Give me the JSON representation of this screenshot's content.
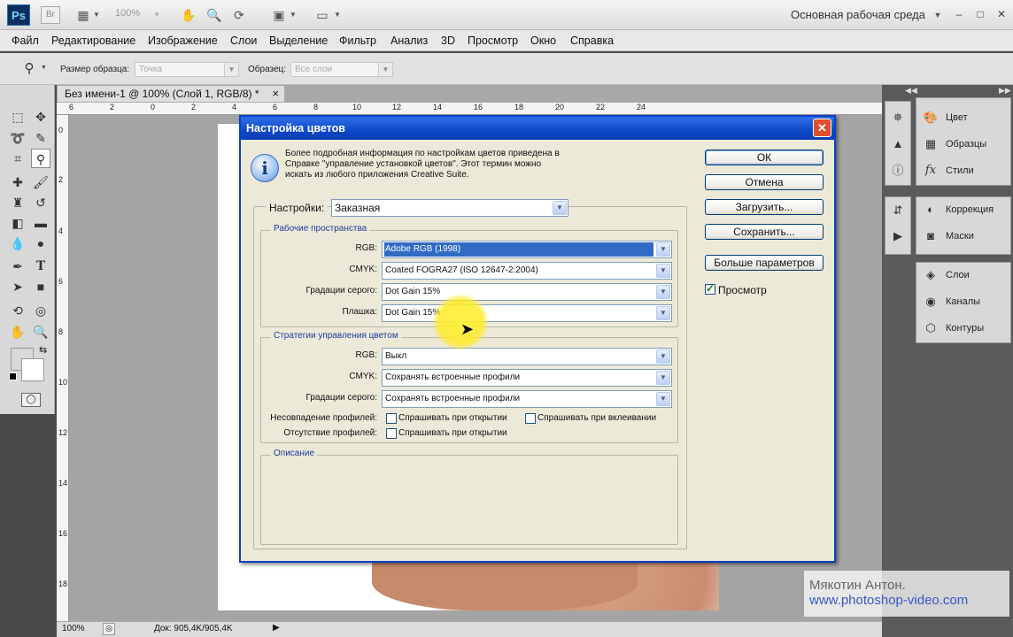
{
  "appbar": {
    "ps_logo": "Ps",
    "br_logo": "Br",
    "zoom": "100%",
    "workspace": "Основная рабочая среда",
    "minimize": "–",
    "maximize": "□",
    "close": "✕"
  },
  "menu": [
    "Файл",
    "Редактирование",
    "Изображение",
    "Слои",
    "Выделение",
    "Фильтр",
    "Анализ",
    "3D",
    "Просмотр",
    "Окно",
    "Справка"
  ],
  "options": {
    "sample_size_label": "Размер образца:",
    "sample_size_value": "Точка",
    "sample_label": "Образец:",
    "sample_value": "Все слои"
  },
  "document": {
    "tab_title": "Без имени-1 @ 100% (Слой 1, RGB/8) *",
    "tab_close": "×",
    "ruler_h": [
      "6",
      "2",
      "0",
      "2",
      "4",
      "6",
      "8",
      "10",
      "12",
      "14",
      "16",
      "18",
      "20",
      "22",
      "24"
    ],
    "ruler_v": [
      "0",
      "2",
      "4",
      "6",
      "8",
      "10",
      "12",
      "14",
      "16",
      "18",
      "20"
    ],
    "status_zoom": "100%",
    "status_doc": "Док: 905,4K/905,4K"
  },
  "panels": {
    "group1": [
      "Цвет",
      "Образцы",
      "Стили"
    ],
    "group2": [
      "Коррекция",
      "Маски"
    ],
    "group3": [
      "Слои",
      "Каналы",
      "Контуры"
    ]
  },
  "watermark": {
    "name": "Мякотин Антон.",
    "url": "www.photoshop-video.com"
  },
  "dialog": {
    "title": "Настройка цветов",
    "close": "✕",
    "info": "Более подробная информация по настройкам цветов приведена в Справке \"управление установкой цветов\". Этот термин можно искать из любого приложения Creative Suite.",
    "settings_label": "Настройки:",
    "settings_value": "Заказная",
    "workspaces_legend": "Рабочие пространства",
    "rgb_label": "RGB:",
    "rgb_value": "Adobe RGB (1998)",
    "cmyk_label": "CMYK:",
    "cmyk_value": "Coated FOGRA27 (ISO 12647-2:2004)",
    "gray_label": "Градации серого:",
    "gray_value": "Dot Gain 15%",
    "spot_label": "Плашка:",
    "spot_value": "Dot Gain 15%",
    "policies_legend": "Стратегии управления цветом",
    "p_rgb_label": "RGB:",
    "p_rgb_value": "Выкл",
    "p_cmyk_label": "CMYK:",
    "p_cmyk_value": "Сохранять встроенные профили",
    "p_gray_label": "Градации серого:",
    "p_gray_value": "Сохранять встроенные профили",
    "mismatch_label": "Несовпадение профилей:",
    "mismatch_open": "Спрашивать при открытии",
    "mismatch_paste": "Спрашивать при вклеивании",
    "missing_label": "Отсутствие профилей:",
    "missing_open": "Спрашивать при открытии",
    "description_legend": "Описание",
    "btn_ok": "ОК",
    "btn_cancel": "Отмена",
    "btn_load": "Загрузить...",
    "btn_save": "Сохранить...",
    "btn_more": "Больше параметров",
    "preview_label": "Просмотр",
    "preview_checked": true
  }
}
